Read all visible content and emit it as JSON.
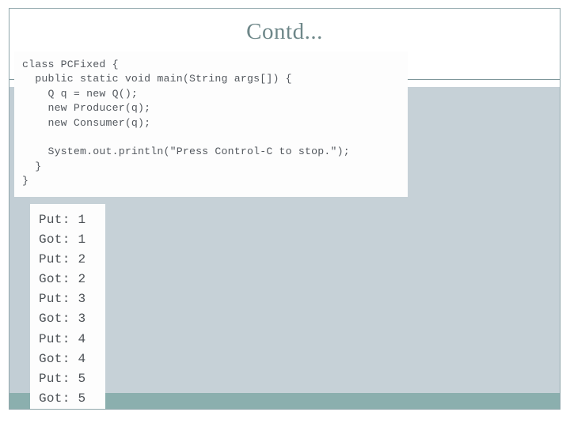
{
  "slide": {
    "title": "Contd...",
    "colors": {
      "title_text": "#6e8789",
      "body_panel": "#c6d1d7",
      "footer_band": "#8bafae",
      "frame_border": "#8fa6ab",
      "code_text": "#53585e",
      "box_background": "#fdfdfd"
    }
  },
  "code_block": {
    "language": "java",
    "lines": [
      "class PCFixed {",
      "  public static void main(String args[]) {",
      "    Q q = new Q();",
      "    new Producer(q);",
      "    new Consumer(q);",
      "",
      "    System.out.println(\"Press Control-C to stop.\");",
      "  }",
      "}"
    ]
  },
  "console_output": {
    "lines": [
      "Put: 1",
      "Got: 1",
      "Put: 2",
      "Got: 2",
      "Put: 3",
      "Got: 3",
      "Put: 4",
      "Got: 4",
      "Put: 5",
      "Got: 5"
    ]
  }
}
